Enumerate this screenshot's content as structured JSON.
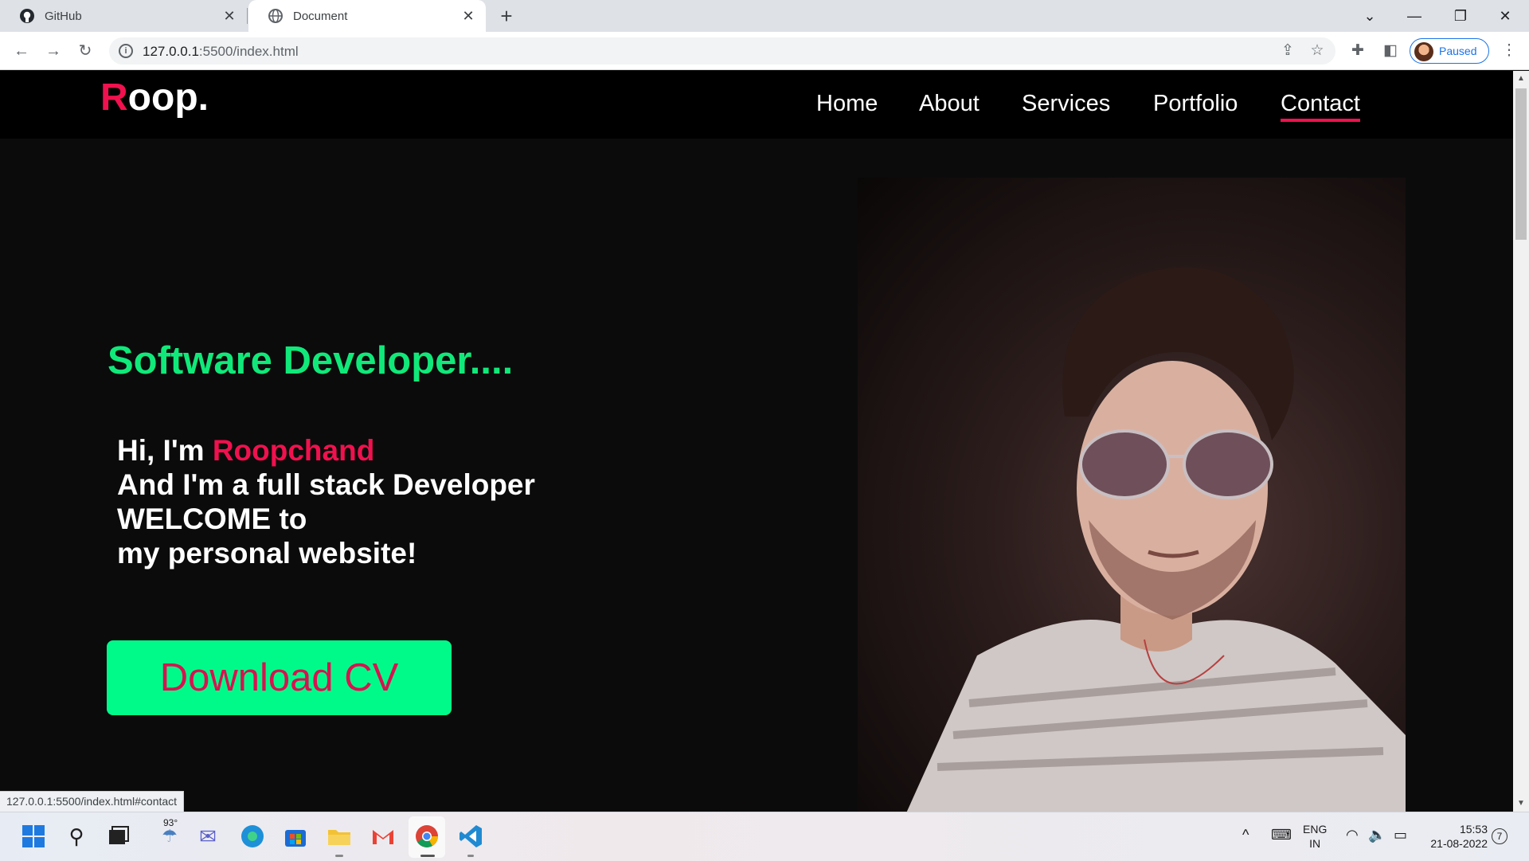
{
  "browser": {
    "tabs": [
      {
        "title": "GitHub",
        "icon": "github-icon"
      },
      {
        "title": "Document",
        "icon": "globe-icon"
      }
    ],
    "new_tab_symbol": "+",
    "url_host": "127.0.0.1",
    "url_rest": ":5500/index.html",
    "profile_label": "Paused",
    "status_url": "127.0.0.1:5500/index.html#contact"
  },
  "site": {
    "logo_accent": "R",
    "logo_rest": "oop.",
    "nav": [
      "Home",
      "About",
      "Services",
      "Portfolio",
      "Contact"
    ],
    "hero_title": "Software Developer....",
    "hero_lines": {
      "greeting": "Hi, I'm ",
      "name": "Roopchand",
      "line2": "And I'm a full stack Developer",
      "line3": "WELCOME to",
      "line4": "my personal website!"
    },
    "cv_button": "Download CV",
    "colors": {
      "accent_pink": "#f0114e",
      "accent_green": "#10e97a",
      "button_green": "#00fa8a"
    }
  },
  "taskbar": {
    "weather": "93°",
    "lang_top": "ENG",
    "lang_bottom": "IN",
    "time": "15:53",
    "date": "21-08-2022",
    "notification_count": "7"
  }
}
